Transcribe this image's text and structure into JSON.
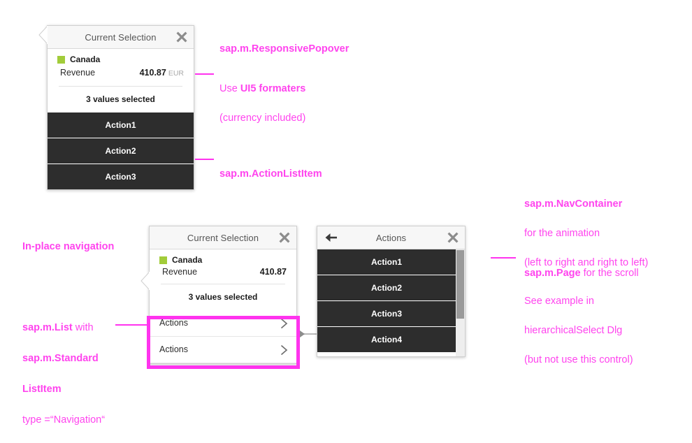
{
  "popover_top": {
    "title": "Current Selection",
    "close_icon": "close-icon",
    "entry": {
      "swatch_color": "#A2CC3A",
      "name": "Canada",
      "measure_label": "Revenue",
      "measure_value": "410.87",
      "measure_unit": "EUR"
    },
    "summary": "3 values selected",
    "actions": [
      "Action1",
      "Action2",
      "Action3"
    ]
  },
  "popover_mid": {
    "title": "Current Selection",
    "close_icon": "close-icon",
    "entry": {
      "swatch_color": "#A2CC3A",
      "name": "Canada",
      "measure_label": "Revenue",
      "measure_value": "410.87"
    },
    "summary": "3 values selected",
    "nav_items": [
      "Actions",
      "Actions"
    ]
  },
  "popover_actions": {
    "title": "Actions",
    "back_icon": "back-arrow-icon",
    "close_icon": "close-icon",
    "actions": [
      "Action1",
      "Action2",
      "Action3",
      "Action4"
    ]
  },
  "annotations": {
    "responsive_popover": "sap.m.ResponsivePopover",
    "formaters_lead": "Use ",
    "formaters_bold": "UI5 formaters",
    "formaters_sub": "(currency included)",
    "action_list_item": "sap.m.ActionListItem",
    "in_place_navigation": "In-place navigation",
    "list_line1_bold": "sap.m.List",
    "list_line1_rest": " with",
    "list_line2_bold": "sap.m.Standard",
    "list_line3_bold": "ListItem",
    "list_line4": "type =“Navigation“",
    "nav_container_bold": "sap.m.NavContainer",
    "nav_container_l2": "for the animation",
    "nav_container_l3": "(left to right and right to left)",
    "page_bold": "sap.m.Page",
    "page_rest": " for the scroll",
    "see_example_l1": "See example in",
    "see_example_l2": "hierarchicalSelect Dlg",
    "see_example_l3": "(but not use this control)"
  },
  "colors": {
    "magenta": "#ff33ee",
    "dark_row": "#2d2d2d",
    "green_swatch": "#A2CC3A",
    "header_bg": "#f7f7f7"
  }
}
